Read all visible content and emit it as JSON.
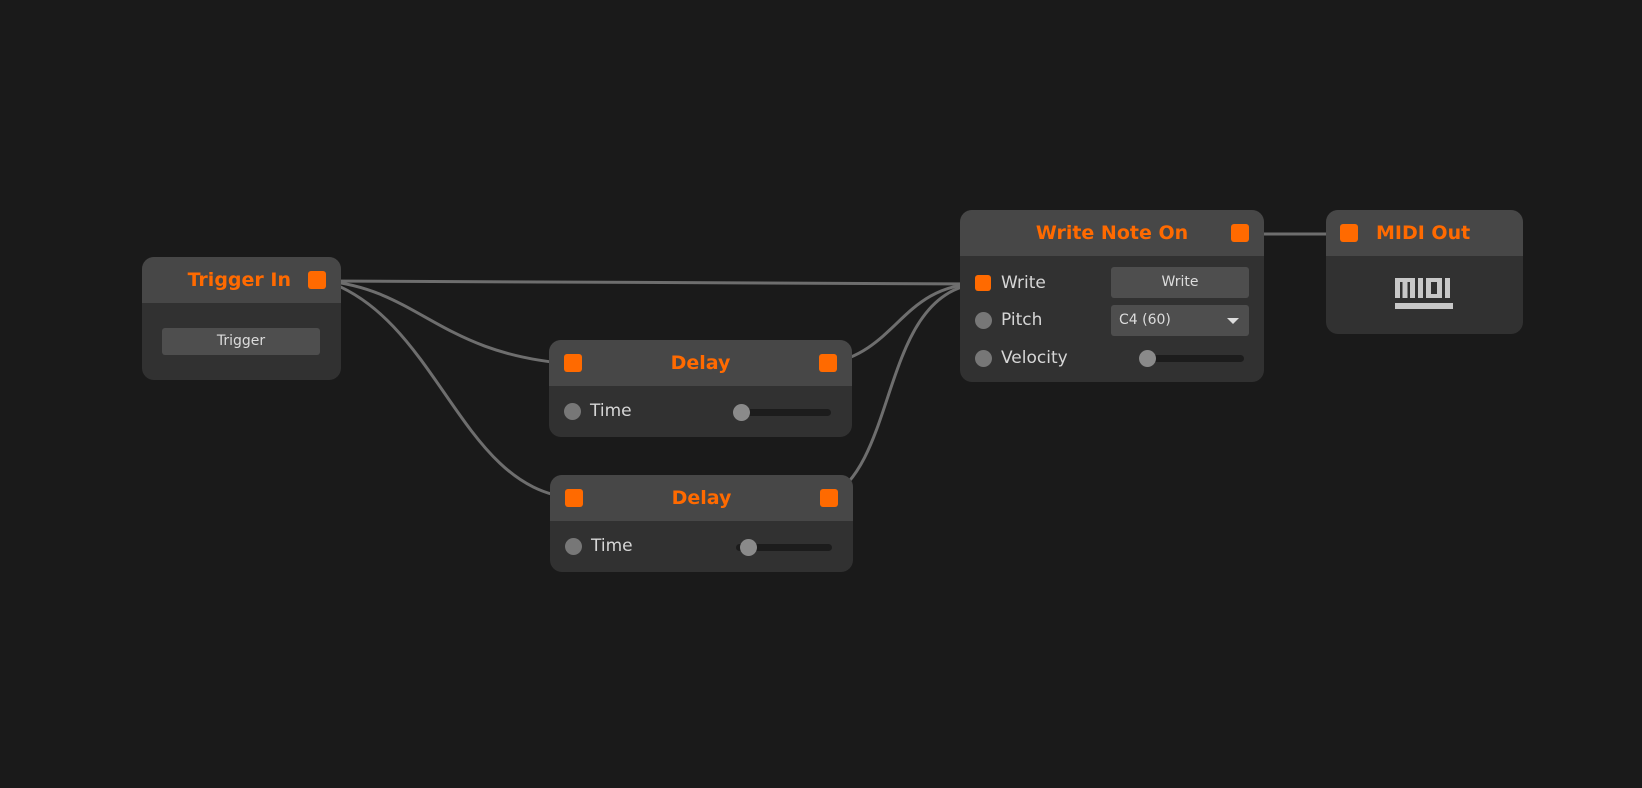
{
  "colors": {
    "accent": "#ff6a00",
    "background": "#1a1a1a",
    "wire": "#6e6e6e"
  },
  "nodes": {
    "trigger_in": {
      "title": "Trigger In",
      "button": "Trigger"
    },
    "delay1": {
      "title": "Delay",
      "time_label": "Time",
      "time_value": 0
    },
    "delay2": {
      "title": "Delay",
      "time_label": "Time",
      "time_value": 0.05
    },
    "write_note_on": {
      "title": "Write Note On",
      "write_label": "Write",
      "write_button": "Write",
      "pitch_label": "Pitch",
      "pitch_value": "C4 (60)",
      "velocity_label": "Velocity",
      "velocity_value": 0
    },
    "midi_out": {
      "title": "MIDI Out",
      "icon": "midi-logo-icon",
      "logo_text": "MIDI"
    }
  }
}
